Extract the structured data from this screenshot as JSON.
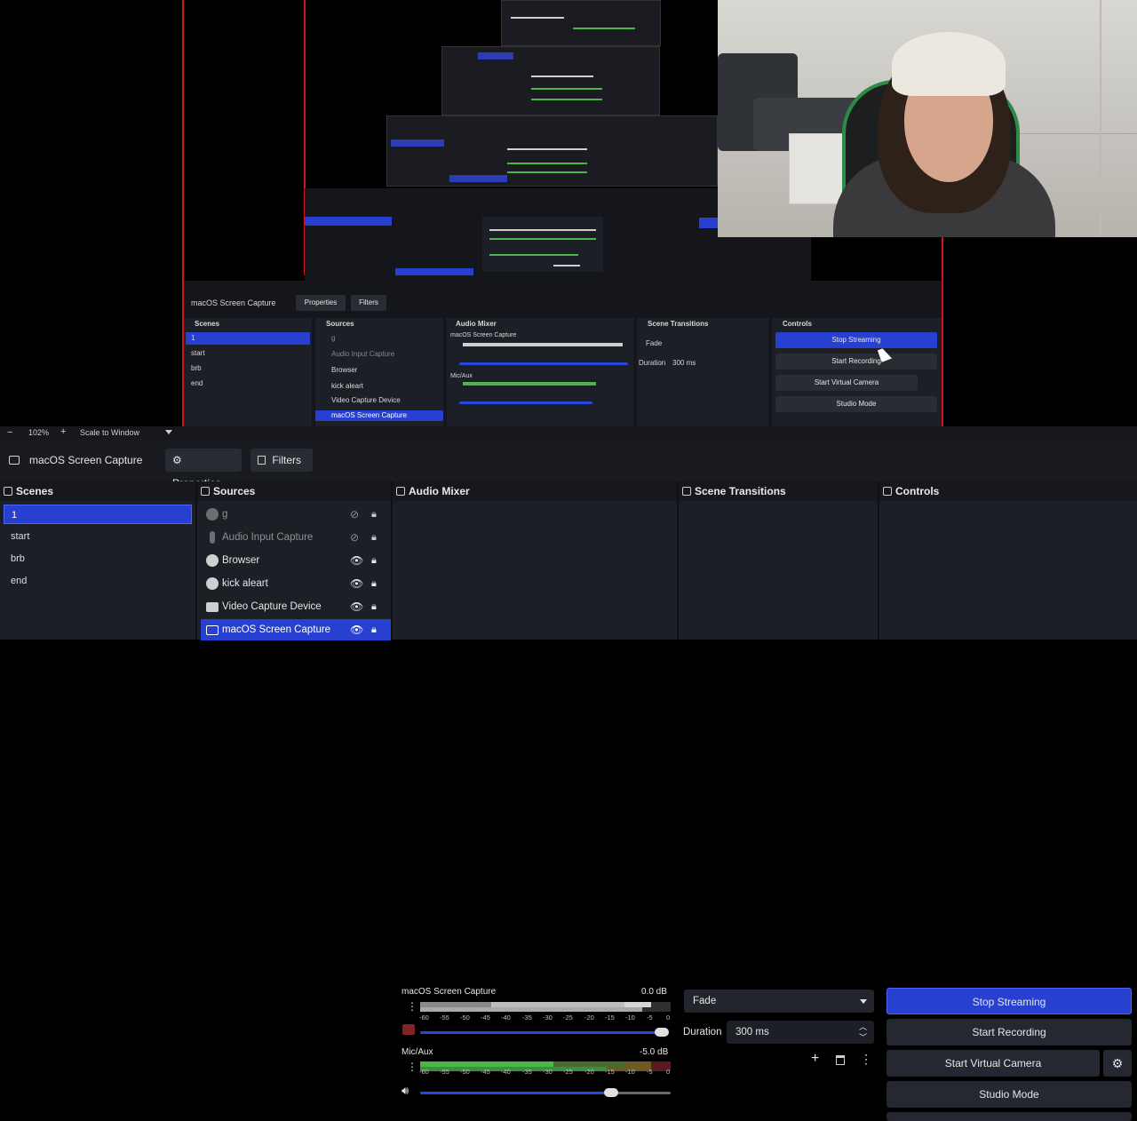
{
  "toolbar": {
    "zoom": "102%",
    "scale_label": "Scale to Window"
  },
  "source_bar": {
    "current_source": "macOS Screen Capture",
    "properties_label": "Properties",
    "filters_label": "Filters"
  },
  "scenes": {
    "title": "Scenes",
    "items": [
      {
        "label": "1",
        "selected": true
      },
      {
        "label": "start"
      },
      {
        "label": "brb"
      },
      {
        "label": "end"
      }
    ]
  },
  "sources": {
    "title": "Sources",
    "items": [
      {
        "label": "g",
        "icon": "microphone-icon",
        "dim": true
      },
      {
        "label": "Audio Input Capture",
        "icon": "microphone-icon",
        "dim": true
      },
      {
        "label": "Browser",
        "icon": "globe-icon"
      },
      {
        "label": "kick aleart",
        "icon": "globe-icon"
      },
      {
        "label": "Video Capture Device",
        "icon": "camera-icon"
      },
      {
        "label": "macOS Screen Capture",
        "icon": "monitor-icon",
        "selected": true
      }
    ]
  },
  "audio_mixer": {
    "title": "Audio Mixer",
    "tick_labels": [
      "-60",
      "-55",
      "-50",
      "-45",
      "-40",
      "-35",
      "-30",
      "-25",
      "-20",
      "-15",
      "-10",
      "-5",
      "0"
    ],
    "channels": [
      {
        "name": "macOS Screen Capture",
        "db": "0.0 dB",
        "level": 1.0
      },
      {
        "name": "Mic/Aux",
        "db": "-5.0 dB",
        "level": 0.74
      }
    ]
  },
  "scene_transitions": {
    "title": "Scene Transitions",
    "transition": "Fade",
    "duration_label": "Duration",
    "duration_value": "300 ms"
  },
  "controls": {
    "title": "Controls",
    "stop_streaming": "Stop Streaming",
    "start_recording": "Start Recording",
    "start_virtual_camera": "Start Virtual Camera",
    "studio_mode": "Studio Mode"
  },
  "colors": {
    "accent": "#2840d0",
    "preview_border": "#d0141e",
    "meter_green": "#49b84a",
    "meter_yellow": "#b7a23b",
    "meter_red": "#b8323a"
  }
}
